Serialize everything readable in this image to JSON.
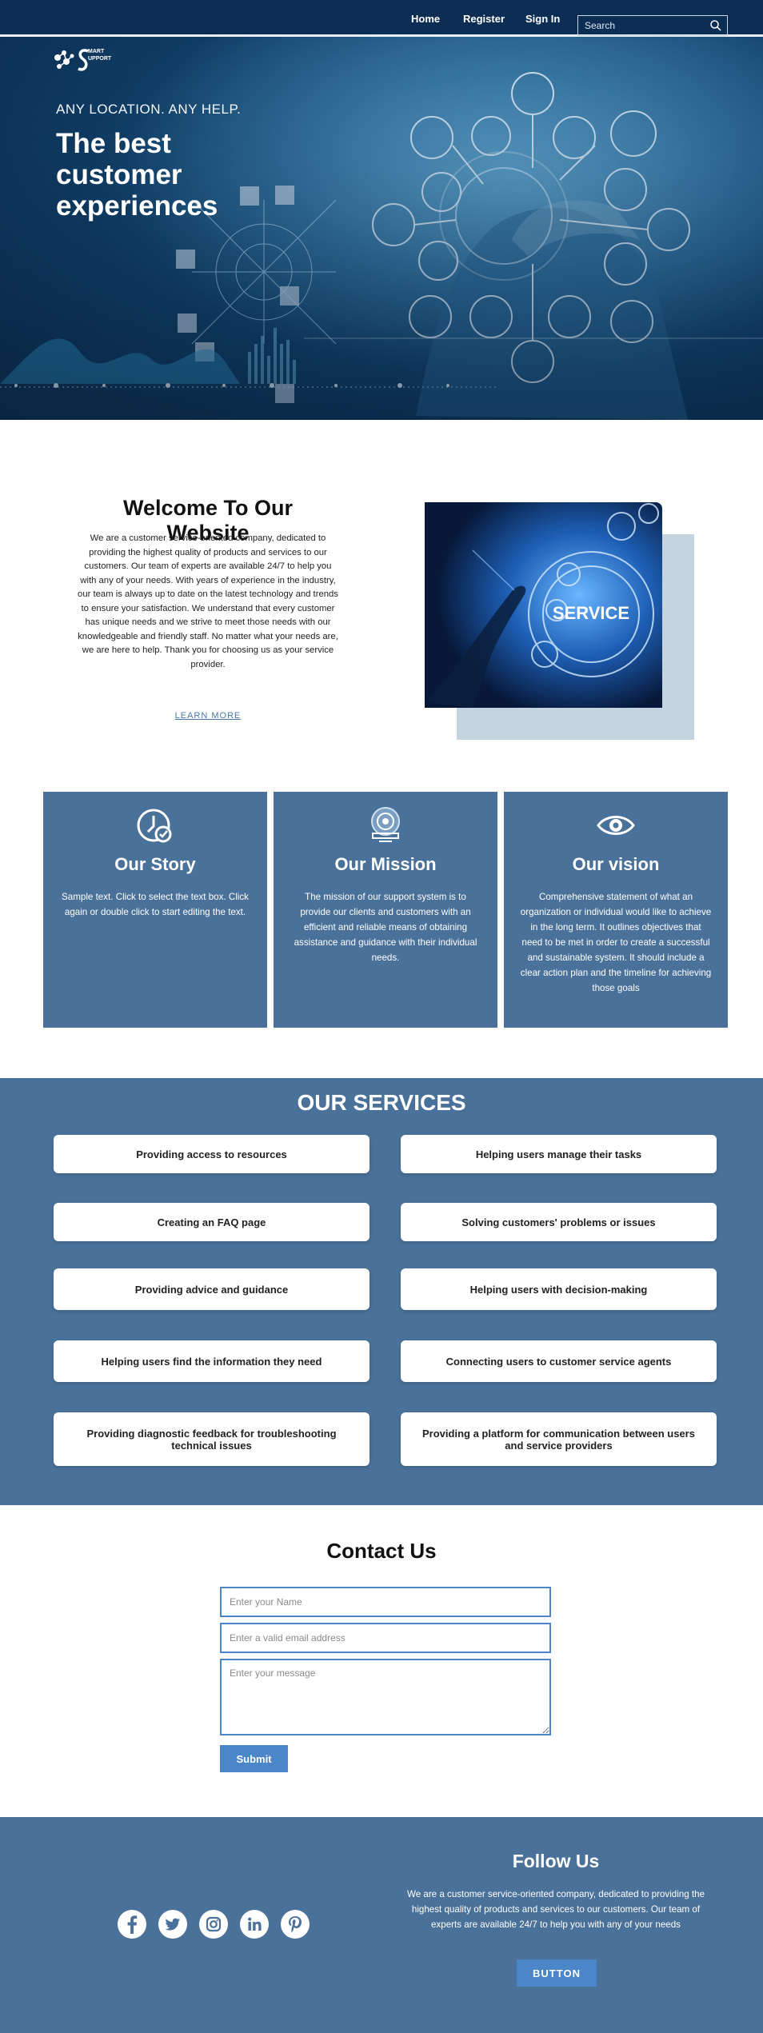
{
  "nav": {
    "links": [
      "Home",
      "Register",
      "Sign In"
    ],
    "search_placeholder": "Search"
  },
  "logo": {
    "line1": "MART",
    "line2": "UPPORT"
  },
  "hero": {
    "tagline": "ANY LOCATION. ANY HELP.",
    "title": "The best customer experiences"
  },
  "welcome": {
    "title": "Welcome To Our Website",
    "text": "We are a customer service-oriented company, dedicated to providing the highest quality of products and services to our customers. Our team of experts are available 24/7 to help you with any of your needs. With years of experience in the industry, our team is always up to date on the latest technology and trends to ensure your satisfaction. We understand that every customer has unique needs and we strive to meet those needs with our knowledgeable and friendly staff. No matter what your needs are, we are here to help. Thank you for choosing us as your service provider.",
    "link": "LEARN MORE",
    "image_label": "SERVICE"
  },
  "features": [
    {
      "icon": "clock-check-icon",
      "title": "Our Story",
      "text": "Sample text. Click to select the text box. Click again or double click to start editing the text."
    },
    {
      "icon": "target-monitor-icon",
      "title": "Our Mission",
      "text": "The mission of our support system is to provide our clients and customers with an efficient and reliable means of obtaining assistance and guidance with their individual needs."
    },
    {
      "icon": "eye-icon",
      "title": "Our vision",
      "text": "Comprehensive statement of what an organization or individual would like to achieve in the long term. It outlines objectives that need to be met in order to create a successful and sustainable system. It should include a clear action plan and the timeline for achieving those goals"
    }
  ],
  "services": {
    "title": "OUR SERVICES",
    "items": [
      "Providing access to resources",
      "Helping users manage their tasks",
      "Creating an FAQ page",
      "Solving customers' problems or issues",
      "Providing advice and guidance",
      "Helping users with decision-making",
      "Helping users find the information they need",
      "Connecting users to customer service agents",
      "Providing diagnostic feedback for troubleshooting technical issues",
      "Providing a platform for communication between users and service providers"
    ]
  },
  "contact": {
    "title": "Contact Us",
    "name_placeholder": "Enter your Name",
    "email_placeholder": "Enter a valid email address",
    "message_placeholder": "Enter your message",
    "submit": "Submit"
  },
  "footer": {
    "social": [
      "facebook-icon",
      "twitter-icon",
      "instagram-icon",
      "linkedin-icon",
      "pinterest-icon"
    ],
    "follow_title": "Follow Us",
    "follow_text": "We are a customer service-oriented company, dedicated to providing the highest quality of products and services to our customers. Our team of experts are available 24/7 to help you with any of your needs",
    "button": "BUTTON"
  },
  "colors": {
    "nav_bg": "#0d2e54",
    "primary_blue": "#4a7199",
    "accent_blue": "#4a86c8",
    "image_shadow": "#c4d5e0"
  }
}
